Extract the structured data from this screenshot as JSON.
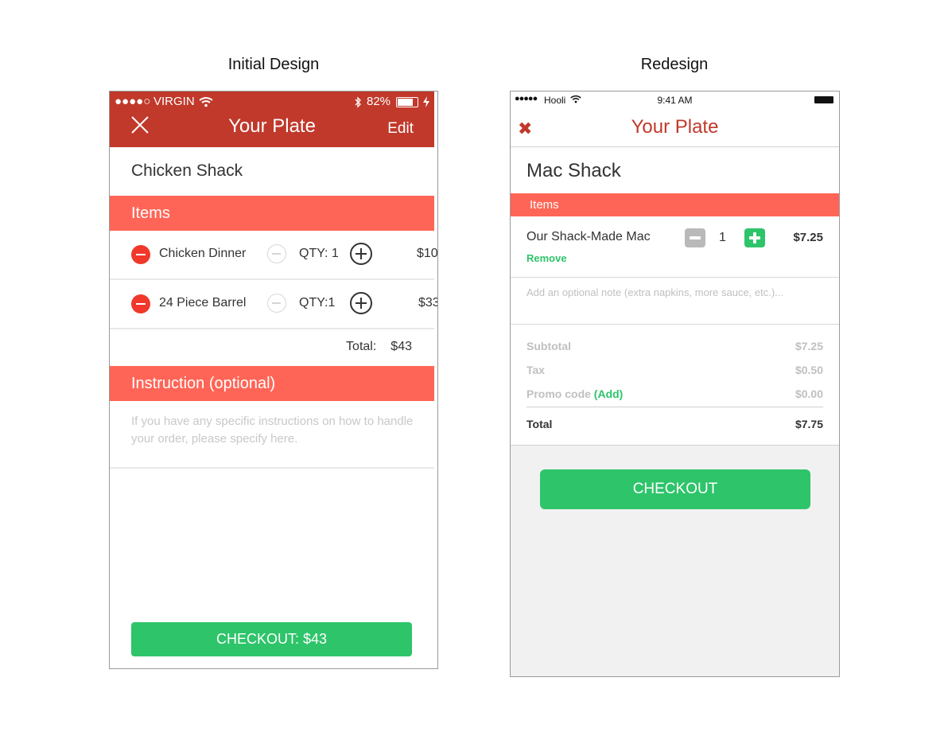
{
  "headings": {
    "initial": "Initial Design",
    "redesign": "Redesign"
  },
  "left": {
    "status": {
      "signal": "●●●●○",
      "carrier": "VIRGIN",
      "wifi": "wifi-icon",
      "bluetooth": "bluetooth-icon",
      "battery_pct": "82%"
    },
    "nav": {
      "close_icon": "close-icon",
      "title": "Your Plate",
      "edit": "Edit"
    },
    "restaurant": "Chicken Shack",
    "items_header": "Items",
    "items": [
      {
        "name": "Chicken Dinner",
        "qty": "QTY: 1",
        "price": "$10"
      },
      {
        "name": "24 Piece Barrel",
        "qty": "QTY:1",
        "price": "$33"
      }
    ],
    "total_label": "Total:",
    "total_value": "$43",
    "instruction_header": "Instruction (optional)",
    "instruction_placeholder": "If you have any specific instructions on how to handle your order, please specify here.",
    "checkout": "CHECKOUT: $43",
    "colors": {
      "nav": "#c0392b",
      "band": "#ff6556",
      "checkout": "#2ec46a"
    }
  },
  "right": {
    "status": {
      "signal": "●●●●●",
      "carrier": "Hooli",
      "time": "9:41 AM"
    },
    "nav": {
      "close_icon": "close-icon",
      "title": "Your Plate"
    },
    "restaurant": "Mac Shack",
    "items_header": "Items",
    "item": {
      "name": "Our Shack-Made Mac",
      "remove": "Remove",
      "qty": "1",
      "price": "$7.25"
    },
    "note_placeholder": "Add an optional note (extra napkins, more sauce, etc.)...",
    "summary": {
      "subtotal_label": "Subtotal",
      "subtotal": "$7.25",
      "tax_label": "Tax",
      "tax": "$0.50",
      "promo_label": "Promo code",
      "promo_add": "(Add)",
      "promo": "$0.00",
      "total_label": "Total",
      "total": "$7.75"
    },
    "checkout": "CHECKOUT",
    "colors": {
      "accent": "#c0392b",
      "band": "#ff6556",
      "checkout": "#2ec46a"
    }
  }
}
